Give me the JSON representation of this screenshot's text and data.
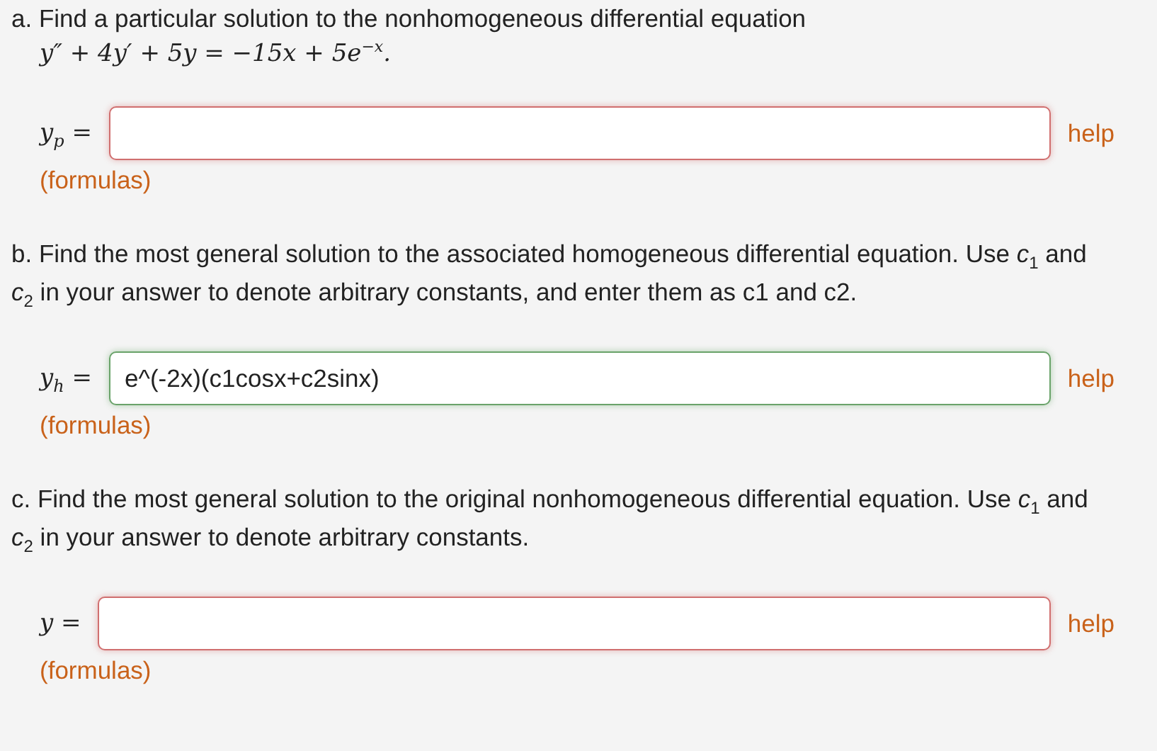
{
  "parts": [
    {
      "prompt": "a. Find a particular solution to the nonhomogeneous differential equation",
      "equation": "y″ + 4y′ + 5y = −15x + 5e$^{−x}$.",
      "answer": {
        "label": "y$_{p}$ =",
        "correct": false,
        "help": "help",
        "formulas": "(formulas)"
      }
    },
    {
      "prompt": "b. Find the most general solution to the associated homogeneous differential equation. Use *c*$_{1}$ and *c*$_{2}$ in your answer to denote arbitrary constants, and enter them as c1 and c2.",
      "answer": {
        "label": "y$_{h}$ =",
        "value": "e^(-2x)(c1cosx+c2sinx)",
        "correct": true,
        "help": "help",
        "formulas": "(formulas)"
      }
    },
    {
      "prompt": "c. Find the most general solution to the original nonhomogeneous differential equation. Use *c*$_{1}$ and *c*$_{2}$ in your answer to denote arbitrary constants.",
      "answer": {
        "label": "y =",
        "correct": false,
        "help": "help",
        "formulas": "(formulas)"
      }
    }
  ]
}
